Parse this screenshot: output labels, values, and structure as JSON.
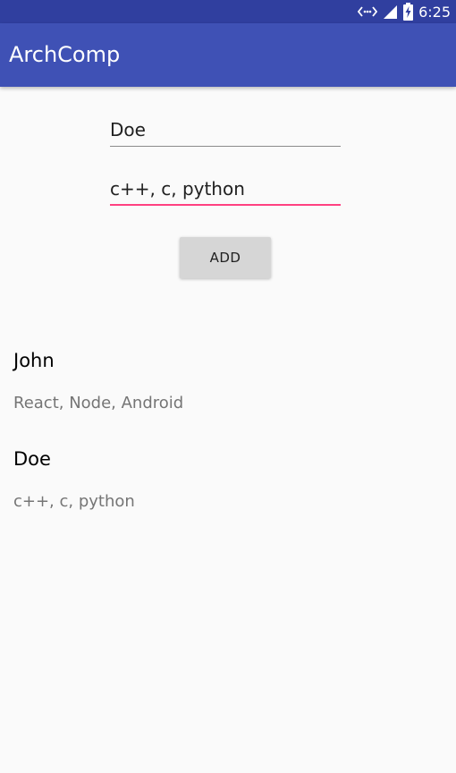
{
  "status_bar": {
    "time": "6:25",
    "icons": [
      "data-transfer-icon",
      "signal-icon",
      "battery-charging-icon"
    ]
  },
  "app_bar": {
    "title": "ArchComp"
  },
  "form": {
    "name_value": "Doe",
    "skills_value": "c++, c, python",
    "add_label": "ADD"
  },
  "entries": [
    {
      "name": "John",
      "skills": "React, Node, Android"
    },
    {
      "name": "Doe",
      "skills": "c++, c, python"
    }
  ],
  "colors": {
    "status_bar": "#303f9f",
    "app_bar": "#3f51b5",
    "accent": "#ff4081",
    "background": "#fafafa"
  }
}
